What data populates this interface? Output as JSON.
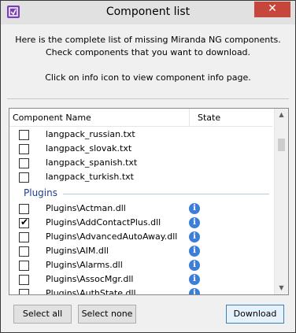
{
  "window": {
    "title": "Component list",
    "close_label": "✕"
  },
  "message": {
    "line1": "Here is the complete list of missing Miranda NG components. Check components that you want to download.",
    "line2": "Click on info icon to view component info page."
  },
  "table": {
    "columns": [
      "Component Name",
      "State"
    ]
  },
  "rows_before": [
    {
      "label": "langpack_russian.txt",
      "checked": false
    },
    {
      "label": "langpack_slovak.txt",
      "checked": false
    },
    {
      "label": "langpack_spanish.txt",
      "checked": false
    },
    {
      "label": "langpack_turkish.txt",
      "checked": false
    }
  ],
  "group": {
    "label": "Plugins"
  },
  "plugin_rows": [
    {
      "label": "Plugins\\Actman.dll",
      "checked": false,
      "icon": "info-icon"
    },
    {
      "label": "Plugins\\AddContactPlus.dll",
      "checked": true,
      "icon": "info-icon"
    },
    {
      "label": "Plugins\\AdvancedAutoAway.dll",
      "checked": false,
      "icon": "info-icon"
    },
    {
      "label": "Plugins\\AIM.dll",
      "checked": false,
      "icon": "info-icon"
    },
    {
      "label": "Plugins\\Alarms.dll",
      "checked": false,
      "icon": "info-icon"
    },
    {
      "label": "Plugins\\AssocMgr.dll",
      "checked": false,
      "icon": "info-icon"
    },
    {
      "label": "Plugins\\AuthState.dll",
      "checked": false,
      "icon": "info-icon"
    }
  ],
  "buttons": {
    "select_all": "Select all",
    "select_none": "Select none",
    "download": "Download"
  },
  "colors": {
    "accent": "#3d7fd6",
    "group_text": "#1e3d8f",
    "close_button": "#c7463b"
  }
}
